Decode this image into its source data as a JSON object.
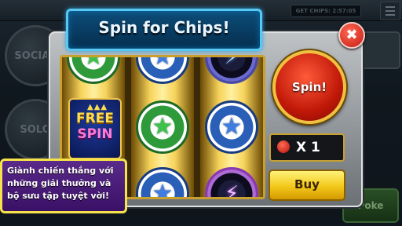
{
  "background": {
    "chips_label": "GET CHIPS: 2:57:05",
    "social_label": "SOCIAL",
    "solo_label": "SOLO",
    "poker_label": "Poke"
  },
  "dialog": {
    "title": "Spin for Chips!",
    "close_icon": "close-x-icon",
    "spin_label": "Spin!",
    "multiplier_label": "X 1",
    "buy_label": "Buy",
    "reels": [
      [
        "green-star-chip",
        "free-spin",
        "blue-star-chip"
      ],
      [
        "blue-star-chip",
        "green-star-chip",
        "blue-star-chip"
      ],
      [
        "lightning-chip",
        "blue-star-chip",
        "purple-lightning-chip"
      ]
    ],
    "free_spin": {
      "line1": "FREE",
      "line2": "SPIN"
    }
  },
  "promo": {
    "line1": "Giành chiến thắng với",
    "line2": "những giải thưởng và",
    "line3": "bộ sưu tập tuyệt vời!"
  },
  "colors": {
    "title_bg": "#0d4d7a",
    "spin_red": "#c01808",
    "buy_gold": "#f2c81a",
    "promo_purple": "#5a2a8a",
    "promo_border": "#f6e24a"
  }
}
